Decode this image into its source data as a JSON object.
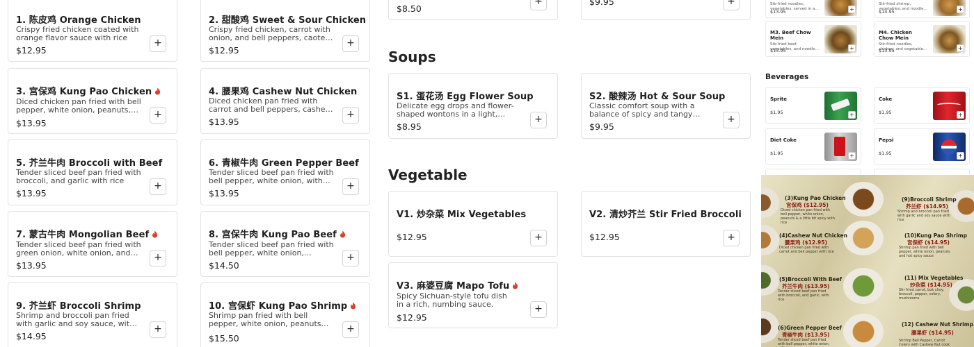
{
  "left_column": [
    {
      "name": "1. 陈皮鸡 Orange Chicken",
      "desc": "Crispy fried chicken coated with orange flavor sauce with rice",
      "price": "$12.95",
      "spicy": false
    },
    {
      "name": "3. 宫保鸡 Kung Pao Chicken",
      "desc": "Diced chicken pan fried with bell pepper, white onion, peanuts, and hot spicy sauce",
      "price": "$13.95",
      "spicy": true
    },
    {
      "name": "5. 芥兰牛肉 Broccoli with Beef",
      "desc": "Tender sliced beef pan fried with broccoli, and garlic with rice",
      "price": "$13.95",
      "spicy": false
    },
    {
      "name": "7. 蒙古牛肉 Mongolian Beef",
      "desc": "Tender sliced beef pan fried with green onion, white onion, and spicy sauce",
      "price": "$13.95",
      "spicy": true
    },
    {
      "name": "9. 芥兰虾 Broccoli Shrimp",
      "desc": "Shrimp and broccoli pan fried with garlic and soy sauce, with rice",
      "price": "$14.95",
      "spicy": false
    }
  ],
  "mid_column": [
    {
      "name": "2. 甜酸鸡 Sweet & Sour Chicken",
      "desc": "Crispy fried chicken, carrot with onion, and bell peppers, caoted with sweet and sour sauce",
      "price": "$12.95",
      "spicy": false
    },
    {
      "name": "4. 腰果鸡 Cashew Nut Chicken",
      "desc": "Diced chicken pan fried with carrot and bell peppers, cashew with rice",
      "price": "$13.95",
      "spicy": false
    },
    {
      "name": "6. 青椒牛肉 Green Pepper Beef",
      "desc": "Tender sliced beef pan fried with bell pepper, white onion, with rice",
      "price": "$13.95",
      "spicy": false
    },
    {
      "name": "8. 宫保牛肉 Kung Pao Beef",
      "desc": "Tender sliced beef pan fried with bell pepper, white onion, peanuts and hot spicy sauce",
      "price": "$14.50",
      "spicy": true
    },
    {
      "name": "10. 宫保虾 Kung Pao Shrimp",
      "desc": "Shrimp pan fried with bell pepper, white onion, peanuts and hot spicy sauce",
      "price": "$15.50",
      "spicy": true
    }
  ],
  "top_partial": {
    "left_price": "$8.50",
    "right_price": "$9.95"
  },
  "soups": {
    "title": "Soups",
    "items": [
      {
        "name": "S1. 蛋花汤 Egg Flower Soup",
        "desc": "Delicate egg drops and flower-shaped wontons in a light, savory broth",
        "price": "$8.95"
      },
      {
        "name": "S2. 酸辣汤 Hot & Sour Soup",
        "desc": "Classic comfort soup with a balance of spicy and tangy flavors in a rich broth",
        "price": "$9.95"
      }
    ]
  },
  "vegetable": {
    "title": "Vegetable",
    "items": [
      {
        "name": "V1. 炒杂菜 Mix Vegetables",
        "desc": "",
        "price": "$12.95",
        "spicy": false
      },
      {
        "name": "V2. 清炒芥兰 Stir Fried Broccoli",
        "desc": "",
        "price": "$12.95",
        "spicy": false
      },
      {
        "name": "V3. 麻婆豆腐 Mapo Tofu",
        "desc": "Spicy Sichuan-style tofu dish in a rich, numbing sauce.",
        "price": "$12.95",
        "spicy": true
      }
    ]
  },
  "side_menu": {
    "noodles_top": [
      {
        "desc": "Stir-fried noodles, vegetables, served in a light sauce",
        "price": "$13.95"
      },
      {
        "desc": "Stir-fried shrimp, vegetables, and noodles in sauce",
        "price": "$14.95"
      }
    ],
    "noodles": [
      {
        "name": "M3. Beef Chow Mein",
        "desc": "Stir-fried beef, vegetables, and noodles in sauce",
        "price": "$13.95"
      },
      {
        "name": "M4. Chicken Chow Mein",
        "desc": "Stir-fried noodles, chicken, and vegetables in sauce",
        "price": "$13.95"
      }
    ],
    "beverages_title": "Beverages",
    "beverages": [
      {
        "name": "Sprite",
        "price": "$1.95",
        "color": "#2e8b3f"
      },
      {
        "name": "Coke",
        "price": "$1.95",
        "color": "#c8141c"
      },
      {
        "name": "Diet Coke",
        "price": "$1.95",
        "color": "#b9b9b9"
      },
      {
        "name": "Pepsi",
        "price": "$1.95",
        "color": "#1c3f94"
      }
    ]
  },
  "photo_menu": {
    "entries": [
      {
        "title": "(3)Kung Pao Chicken",
        "cn": "宫保鸡 ($12.95)",
        "sub": "Diced chicken pan fried with bell pepper, white onion, peanuts & a little bit spicy with rice"
      },
      {
        "title": "(9)Broccoli Shrimp",
        "cn": "芥兰虾 ($14.95)",
        "sub": "Shrimp and broccoli pan fried with garlic and soy sauce with rice"
      },
      {
        "title": "(4)Cashew Nut Chicken",
        "cn": "腰果鸡 ($12.95)",
        "sub": "Diced chicken pan fried with carrot and bell pepper with rice"
      },
      {
        "title": "(10)Kung Pao Shrimp",
        "cn": "宫保虾 ($14.95)",
        "sub": "Shrimp pan fried with bell pepper, white onion, peanuts and hot spicy sauce"
      },
      {
        "title": "(5)Broccoli With Beef",
        "cn": "芥兰牛肉 ($13.95)",
        "sub": "Tender sliced beef pan fried with broccoli, and garlic, with rice"
      },
      {
        "title": "(11) Mix Vegetables",
        "cn": "炒杂菜 ($14.95)",
        "sub": "Stir fried carrot, bok choy, broccoli, pepper, celery, mushrooms"
      },
      {
        "title": "(6)Green Pepper Beef",
        "cn": "青椒牛肉 ($13.95)",
        "sub": "Tender sliced beef pan fried with bell pepper, white onion, with rice"
      },
      {
        "title": "(12) Cashew Nut Shrimp",
        "cn": "腰果虾 ($14.95)",
        "sub": "Shrimp Bell Pepper, Carrot Celery with Cashew Nut cook with Chef Sauce"
      }
    ]
  },
  "icons": {
    "add": "+",
    "spicy": "chili-pepper-icon"
  },
  "colors": {
    "spicy": "#d9412b",
    "card_border": "#e2e2e2"
  }
}
